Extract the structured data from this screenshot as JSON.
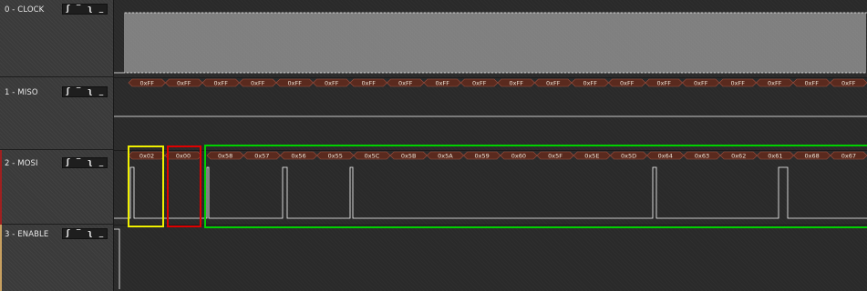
{
  "channels": [
    {
      "label": "0 - CLOCK"
    },
    {
      "label": "1 - MISO"
    },
    {
      "label": "2 - MOSI"
    },
    {
      "label": "3 - ENABLE"
    }
  ],
  "trigger_icons": [
    "rising-edge-icon",
    "high-level-icon",
    "falling-edge-icon",
    "low-level-icon"
  ],
  "trigger_glyphs": [
    "ʃ",
    "‾",
    "ʅ",
    "_"
  ],
  "miso_packets": [
    "0xFF",
    "0xFF",
    "0xFF",
    "0xFF",
    "0xFF",
    "0xFF",
    "0xFF",
    "0xFF",
    "0xFF",
    "0xFF",
    "0xFF",
    "0xFF",
    "0xFF",
    "0xFF",
    "0xFF",
    "0xFF",
    "0xFF",
    "0xFF",
    "0xFF",
    "0xFF"
  ],
  "mosi_packets": [
    "0x02",
    "0x00",
    "0x58",
    "0x57",
    "0x56",
    "0x55",
    "0x5C",
    "0x5B",
    "0x5A",
    "0x59",
    "0x60",
    "0x5F",
    "0x5E",
    "0x5D",
    "0x64",
    "0x63",
    "0x62",
    "0x61",
    "0x68",
    "0x67"
  ],
  "colors": {
    "highlight_yellow": "#f0f000",
    "highlight_red": "#e00000",
    "highlight_green": "#00d000",
    "packet_fill": "#5a2a1e",
    "signal": "#ffffff"
  }
}
